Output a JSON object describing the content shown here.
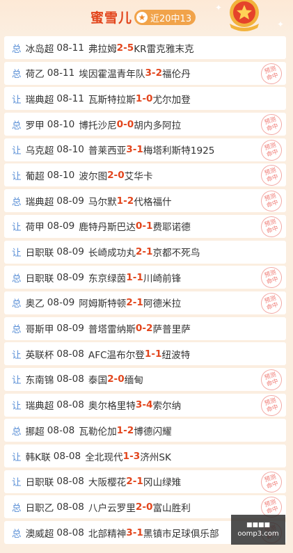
{
  "header": {
    "title": "蜜雪儿",
    "badge_star": "★",
    "badge_text": "近20中13"
  },
  "hit_stamp": {
    "line1": "预测",
    "line2": "命中"
  },
  "watermark": {
    "top": "■■■■",
    "bottom": "oomp3.com"
  },
  "colors": {
    "accent": "#e2451c",
    "tag": "#5a8fd6",
    "stamp": "#ef7a74",
    "badge": "#f1a34a"
  },
  "matches": [
    {
      "tag": "总",
      "league": "冰岛超",
      "date": "08-11",
      "home": "弗拉姆",
      "h": "2",
      "sep": " - ",
      "a": "5",
      "away": "KR雷克雅末克",
      "hit": false
    },
    {
      "tag": "总",
      "league": "荷乙",
      "date": "08-11",
      "home": "埃因霍温青年队",
      "h": "3",
      "sep": " - ",
      "a": "2",
      "away": "福伦丹",
      "hit": true
    },
    {
      "tag": "让",
      "league": "瑞典超",
      "date": "08-11",
      "home": "瓦斯特拉斯",
      "h": "1",
      "sep": " - ",
      "a": "0",
      "away": "尤尔加登",
      "hit": false
    },
    {
      "tag": "总",
      "league": "罗甲",
      "date": "08-10",
      "home": "博托沙尼",
      "h": "0",
      "sep": " - ",
      "a": "0",
      "away": "胡内多阿拉",
      "hit": true
    },
    {
      "tag": "让",
      "league": "乌克超",
      "date": "08-10",
      "home": "普莱西亚",
      "h": "3",
      "sep": " - ",
      "a": "1",
      "away": "梅塔利斯特1925",
      "hit": true
    },
    {
      "tag": "让",
      "league": "葡超",
      "date": "08-10",
      "home": "波尔图",
      "h": "2",
      "sep": " - ",
      "a": "0",
      "away": "艾华卡",
      "hit": true
    },
    {
      "tag": "总",
      "league": "瑞典超",
      "date": "08-09",
      "home": "马尔默",
      "h": "1",
      "sep": " - ",
      "a": "2",
      "away": "代格福什",
      "hit": true
    },
    {
      "tag": "让",
      "league": "荷甲",
      "date": "08-09",
      "home": "鹿特丹斯巴达",
      "h": "0",
      "sep": " - ",
      "a": "1",
      "away": "费耶诺德",
      "hit": true
    },
    {
      "tag": "让",
      "league": "日职联",
      "date": "08-09",
      "home": "长崎成功丸",
      "h": "2",
      "sep": " - ",
      "a": "1",
      "away": "京都不死鸟",
      "hit": false
    },
    {
      "tag": "总",
      "league": "日职联",
      "date": "08-09",
      "home": "东京绿茵",
      "h": "1",
      "sep": " - ",
      "a": "1",
      "away": "川崎前锋",
      "hit": true
    },
    {
      "tag": "总",
      "league": "奥乙",
      "date": "08-09",
      "home": "阿姆斯特顿",
      "h": "2",
      "sep": " - ",
      "a": "1",
      "away": "阿德米拉",
      "hit": true
    },
    {
      "tag": "总",
      "league": "哥斯甲",
      "date": "08-09",
      "home": "普塔雷纳斯",
      "h": "0",
      "sep": " - ",
      "a": "2",
      "away": "萨普里萨",
      "hit": false
    },
    {
      "tag": "让",
      "league": "英联杯",
      "date": "08-08",
      "home": "AFC温布尔登",
      "h": "1",
      "sep": " - ",
      "a": "1",
      "away": "纽波特",
      "hit": false
    },
    {
      "tag": "让",
      "league": "东南锦",
      "date": "08-08",
      "home": "泰国",
      "h": "2",
      "sep": " - ",
      "a": "0",
      "away": "缅甸",
      "hit": true
    },
    {
      "tag": "让",
      "league": "瑞典超",
      "date": "08-08",
      "home": "奥尔格里特",
      "h": "3",
      "sep": " - ",
      "a": "4",
      "away": "索尔纳",
      "hit": true
    },
    {
      "tag": "总",
      "league": "挪超",
      "date": "08-08",
      "home": "瓦勒伦加",
      "h": "1",
      "sep": " - ",
      "a": "2",
      "away": "博德闪耀",
      "hit": false
    },
    {
      "tag": "让",
      "league": "韩K联",
      "date": "08-08",
      "home": "全北现代",
      "h": "1",
      "sep": " - ",
      "a": "3",
      "away": "济州SK",
      "hit": false
    },
    {
      "tag": "让",
      "league": "日职联",
      "date": "08-08",
      "home": "大阪樱花",
      "h": "2",
      "sep": " - ",
      "a": "1",
      "away": "冈山绿雉",
      "hit": true
    },
    {
      "tag": "总",
      "league": "日职乙",
      "date": "08-08",
      "home": "八户云罗里",
      "h": "2",
      "sep": " - ",
      "a": "0",
      "away": "富山胜利",
      "hit": true
    },
    {
      "tag": "总",
      "league": "澳威超",
      "date": "08-08",
      "home": "北部精神",
      "h": "3",
      "sep": " - ",
      "a": "1",
      "away": "黑镇市足球俱乐部",
      "hit": true
    }
  ]
}
